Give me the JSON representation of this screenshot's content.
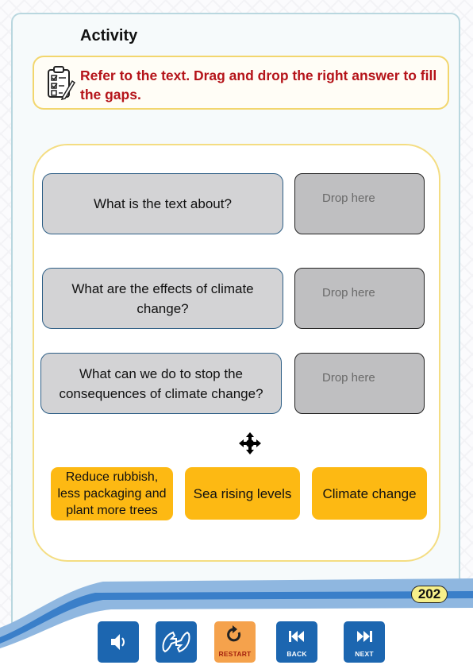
{
  "activity": {
    "title": "Activity",
    "instruction": "Refer to the text. Drag and drop the right answer to fill the gaps."
  },
  "questions": [
    {
      "text": "What is the text about?",
      "drop_label": "Drop here"
    },
    {
      "text": "What are the effects of climate change?",
      "drop_label": "Drop here"
    },
    {
      "text": "What can we do to stop the consequences of climate change?",
      "drop_label": "Drop here"
    }
  ],
  "answers": [
    {
      "text": "Reduce rubbish, less packaging and plant more trees"
    },
    {
      "text": "Sea rising levels"
    },
    {
      "text": "Climate change"
    }
  ],
  "page_number": "202",
  "nav": {
    "audio_icon": "speaker-icon",
    "sign_icon": "sign-language-icon",
    "restart_label": "RESTART",
    "back_label": "BACK",
    "next_label": "NEXT"
  },
  "colors": {
    "instruction_text": "#b5141a",
    "answer_bg": "#fdb913",
    "nav_blue": "#1c66b0",
    "restart_orange": "#f5a24c"
  }
}
